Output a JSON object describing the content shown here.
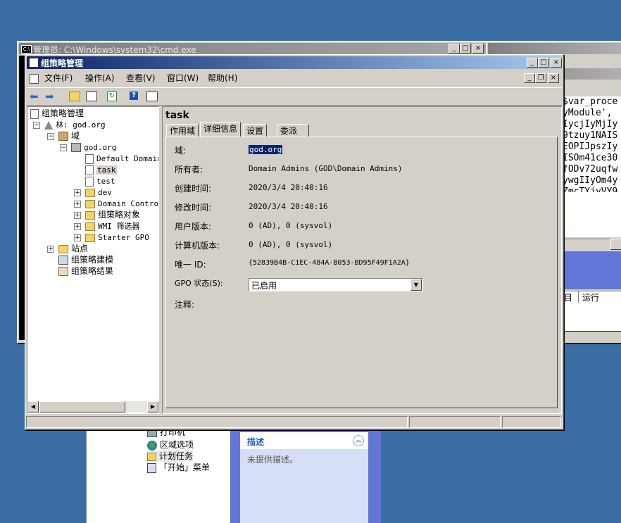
{
  "cmd_window": {
    "title": "管理员: C:\\Windows\\system32\\cmd.exe",
    "text_lines": [
      "$var_proce",
      "yModule',",
      "IycjIyMjIy",
      "9tzuy1NAIS",
      "EOPIJpszIy",
      "ISOm41ce30",
      "fODv72uqfw",
      "ywgIIyOm4y",
      "ZmcTYjyVY9"
    ]
  },
  "bg_window": {
    "col_run": "运行",
    "list_items": [
      {
        "label": "打印机",
        "icon": "printer-icon"
      },
      {
        "label": "区域选项",
        "icon": "globe-icon"
      },
      {
        "label": "计划任务",
        "icon": "scheduled-task-icon"
      },
      {
        "label": "「开始」菜单",
        "icon": "start-menu-icon"
      }
    ],
    "desc_title": "描述",
    "desc_text": "未提供描述。"
  },
  "gpm_window": {
    "title": "组策略管理",
    "menu": [
      "文件(F)",
      "操作(A)",
      "查看(V)",
      "窗口(W)",
      "帮助(H)"
    ],
    "tree": {
      "root": "组策略管理",
      "forest": "林: god.org",
      "domains": "域",
      "domain": "god.org",
      "items": [
        "Default Domain",
        "task",
        "test",
        "dev",
        "Domain Control",
        "组策略对象",
        "WMI 筛选器",
        "Starter GPO"
      ],
      "sites": "站点",
      "modeling": "组策略建模",
      "results": "组策略结果"
    },
    "detail": {
      "heading": "task",
      "tabs": [
        "作用域",
        "详细信息",
        "设置",
        "委派"
      ],
      "fields": [
        {
          "label": "域:",
          "value": "god.org"
        },
        {
          "label": "所有者:",
          "value": "Domain Admins (GOD\\Domain Admins)"
        },
        {
          "label": "创建时间:",
          "value": "2020/3/4 20:40:16"
        },
        {
          "label": "修改时间:",
          "value": "2020/3/4 20:40:16"
        },
        {
          "label": "用户版本:",
          "value": "0 (AD), 0 (sysvol)"
        },
        {
          "label": "计算机版本:",
          "value": "0 (AD), 0 (sysvol)"
        },
        {
          "label": "唯一 ID:",
          "value": "{52839B4B-C1EC-484A-B053-BD95F49F1A2A}"
        }
      ],
      "status_label": "GPO 状态(S):",
      "status_value": "已启用",
      "comment_label": "注释:"
    }
  }
}
